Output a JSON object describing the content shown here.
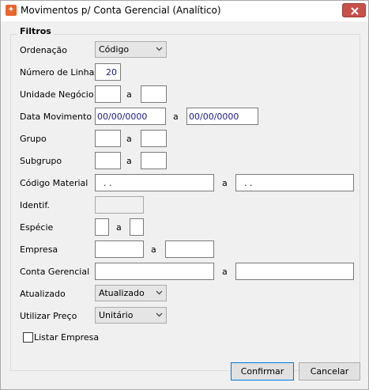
{
  "window": {
    "title": "Movimentos p/ Conta Gerencial (Analítico)",
    "accent": "#c7504b"
  },
  "group": {
    "title": "Filtros"
  },
  "labels": {
    "ordenacao": "Ordenação",
    "numero_linhas": "Número de Linhas",
    "unidade_negocio": "Unidade Negócio",
    "data_movimento": "Data Movimento",
    "grupo": "Grupo",
    "subgrupo": "Subgrupo",
    "codigo_material": "Código Material",
    "identif": "Identif.",
    "especie": "Espécie",
    "empresa": "Empresa",
    "conta_gerencial": "Conta Gerencial",
    "atualizado": "Atualizado",
    "utilizar_preco": "Utilizar Preço",
    "a": "a"
  },
  "fields": {
    "ordenacao": "Código",
    "numero_linhas": "20",
    "data_de": "00/00/0000",
    "data_ate": "00/00/0000",
    "material_de": ".  .",
    "material_ate": ".  .",
    "atualizado": "Atualizado",
    "utilizar_preco": "Unitário"
  },
  "checkbox": {
    "label": "Listar Empresa",
    "checked": false
  },
  "buttons": {
    "confirmar": "Confirmar",
    "cancelar": "Cancelar"
  }
}
